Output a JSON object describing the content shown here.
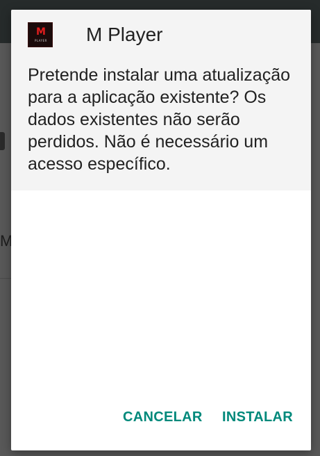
{
  "background": {
    "partial_text": "M"
  },
  "dialog": {
    "app_name": "M Player",
    "icon": {
      "name": "m-player-app-icon",
      "letter": "M",
      "sub_label": "PLAYER"
    },
    "message": "Pretende instalar uma atualização para a aplicação existente? Os dados existentes não serão perdidos. Não é necessário um acesso específico.",
    "buttons": {
      "cancel_label": "CANCELAR",
      "install_label": "INSTALAR"
    }
  },
  "colors": {
    "accent": "#00897b",
    "dialog_header_bg": "#f4f4f4",
    "scrim": "#585858",
    "icon_red": "#e01e1e"
  }
}
